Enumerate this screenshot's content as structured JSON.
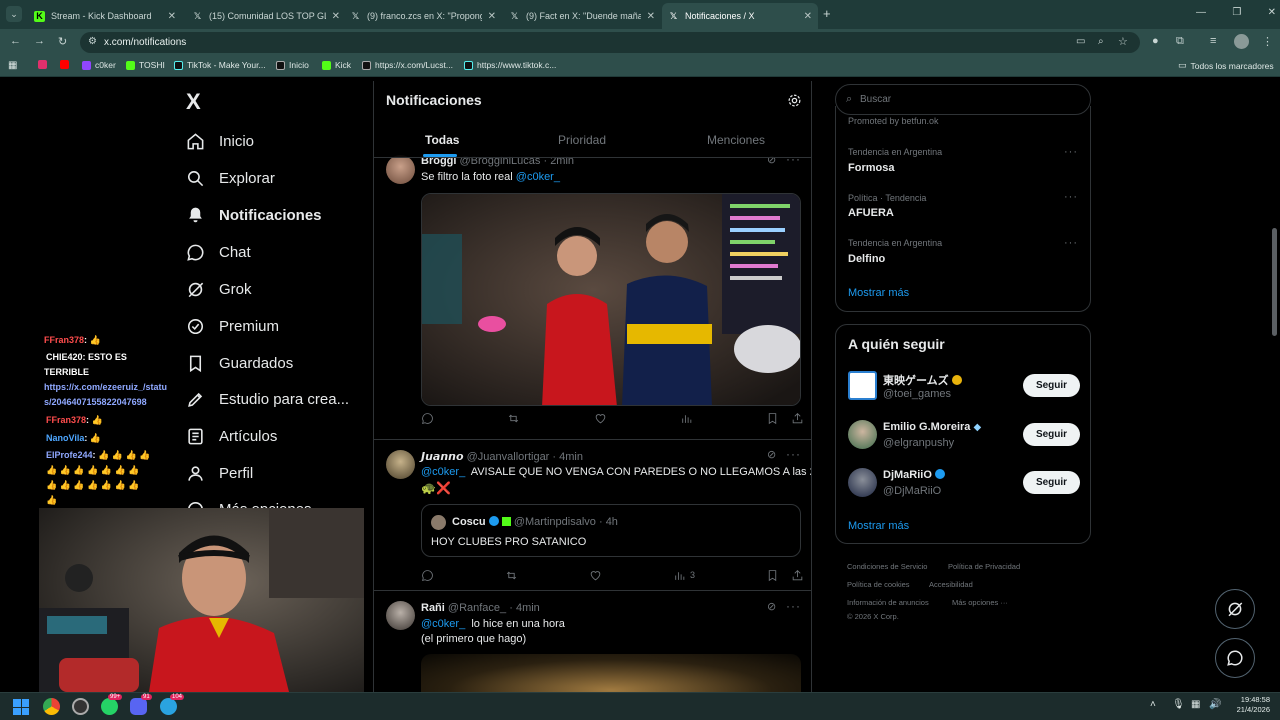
{
  "browser": {
    "tabs": [
      {
        "label": "Stream - Kick Dashboard",
        "icon": "kick-icon"
      },
      {
        "label": "(15) Comunidad LOS TOP GLOB",
        "icon": "x-icon"
      },
      {
        "label": "(9) franco.zcs en X: \"Propongo",
        "icon": "x-icon"
      },
      {
        "label": "(9) Fact en X: \"Duende mañana",
        "icon": "x-icon"
      },
      {
        "label": "Notificaciones / X",
        "icon": "x-icon"
      }
    ],
    "close_glyph": "✕",
    "new_tab_glyph": "+",
    "url": "x.com/notifications",
    "bookmarks": [
      {
        "label": "",
        "color": "#e1306c"
      },
      {
        "label": "",
        "color": "#ff0000"
      },
      {
        "label": "c0ker",
        "color": "#9146ff"
      },
      {
        "label": "TOSHI",
        "color": "#53fc18"
      },
      {
        "label": "TikTok - Make Your...",
        "color": "#000000"
      },
      {
        "label": "Inicio",
        "color": "#000000"
      },
      {
        "label": "Kick",
        "color": "#53fc18"
      },
      {
        "label": "https://x.com/Lucst...",
        "color": "#000000"
      },
      {
        "label": "https://www.tiktok.c...",
        "color": "#000000"
      }
    ],
    "all_bookmarks": "Todos los marcadores"
  },
  "nav": {
    "logo": "X",
    "items": [
      {
        "label": "Inicio",
        "icon": "home-icon"
      },
      {
        "label": "Explorar",
        "icon": "search-icon"
      },
      {
        "label": "Notificaciones",
        "icon": "bell-icon"
      },
      {
        "label": "Chat",
        "icon": "chat-icon"
      },
      {
        "label": "Grok",
        "icon": "grok-icon"
      },
      {
        "label": "Premium",
        "icon": "premium-icon"
      },
      {
        "label": "Guardados",
        "icon": "bookmark-icon"
      },
      {
        "label": "Estudio para crea...",
        "icon": "studio-icon"
      },
      {
        "label": "Artículos",
        "icon": "articles-icon"
      },
      {
        "label": "Perfil",
        "icon": "profile-icon"
      },
      {
        "label": "Más opciones",
        "icon": "more-icon"
      }
    ]
  },
  "main": {
    "title": "Notificaciones",
    "tabs": [
      "Todas",
      "Prioridad",
      "Menciones"
    ],
    "posts": [
      {
        "name": "Broggi",
        "handle": "@BrogginiLucas",
        "time": "· 2min",
        "mention": "@c0ker_",
        "text_before": "Se filtro la foto real ",
        "text_after": "",
        "views": ""
      },
      {
        "name": "𝙅𝙪𝙖𝙣𝙣𝙤",
        "handle": "@Juanvallortigar",
        "time": "· 4min",
        "mention": "@c0ker_",
        "text": "AVISALE QUE NO VENGA CON PAREDES O NO LLEGAMOS A las 22",
        "emoji": "🐢❌",
        "quote": {
          "name": "Coscu",
          "handle": "@Martinpdisalvo",
          "time": "· 4h",
          "text": "HOY CLUBES PRO SATANICO"
        },
        "views": "3"
      },
      {
        "name": "Rañi",
        "handle": "@Ranface_",
        "time": "· 4min",
        "mention": "@c0ker_",
        "line1": "lo hice en una hora",
        "line2": "(el primero que hago)"
      }
    ]
  },
  "right": {
    "search_placeholder": "Buscar",
    "promoted": "Promoted by betfun.ok",
    "trends": [
      {
        "category": "Tendencia en Argentina",
        "name": "Formosa"
      },
      {
        "category": "Política · Tendencia",
        "name": "AFUERA"
      },
      {
        "category": "Tendencia en Argentina",
        "name": "Delfino"
      }
    ],
    "show_more": "Mostrar más",
    "who_to_follow": "A quién seguir",
    "follow_label": "Seguir",
    "follows": [
      {
        "name": "東映ゲームズ",
        "handle": "@toei_games"
      },
      {
        "name": "Emilio G.Moreira",
        "handle": "@elgranpushy"
      },
      {
        "name": "DjMaRiiO",
        "handle": "@DjMaRiiO"
      }
    ],
    "footer": [
      "Condiciones de Servicio",
      "Política de Privacidad",
      "Política de cookies",
      "Accesibilidad",
      "Información de anuncios",
      "Más opciones ···",
      "© 2026 X Corp."
    ]
  },
  "stream_chat": [
    {
      "user": "FFran378",
      "text": ": 👍",
      "color": "#ff4d4d"
    },
    {
      "user": "CHIE420",
      "text": ": ESTO ES",
      "color": "#ffffff"
    },
    {
      "user": "TERRIBLE",
      "text": "",
      "color": "#ffffff"
    },
    {
      "user": "https://x.com/ezeeruiz_/statu",
      "text": "",
      "color": "#8fa8ff"
    },
    {
      "user": "s/2046407155822047698",
      "text": "",
      "color": "#8fa8ff"
    },
    {
      "user": "FFran378",
      "text": ": 👍",
      "color": "#ff4d4d"
    },
    {
      "user": "NanoVila",
      "text": ": 👍",
      "color": "#4da6ff"
    },
    {
      "user": "ElProfe244",
      "text": ": 👍 👍 👍 👍",
      "color": "#8fa8ff"
    },
    {
      "user": "👍 👍 👍 👍 👍 👍 👍",
      "text": "",
      "color": "#ffffff"
    },
    {
      "user": "👍 👍 👍 👍 👍 👍 👍",
      "text": "",
      "color": "#ffffff"
    },
    {
      "user": "👍",
      "text": "",
      "color": "#ffffff"
    }
  ],
  "taskbar": {
    "time": "19:48:58",
    "date": "21/4/2026",
    "badges": [
      "99+",
      "91",
      "104"
    ]
  },
  "colors": {
    "accent": "#1d9bf0",
    "bg": "#000000",
    "border": "#2f3336",
    "muted": "#71767b"
  }
}
